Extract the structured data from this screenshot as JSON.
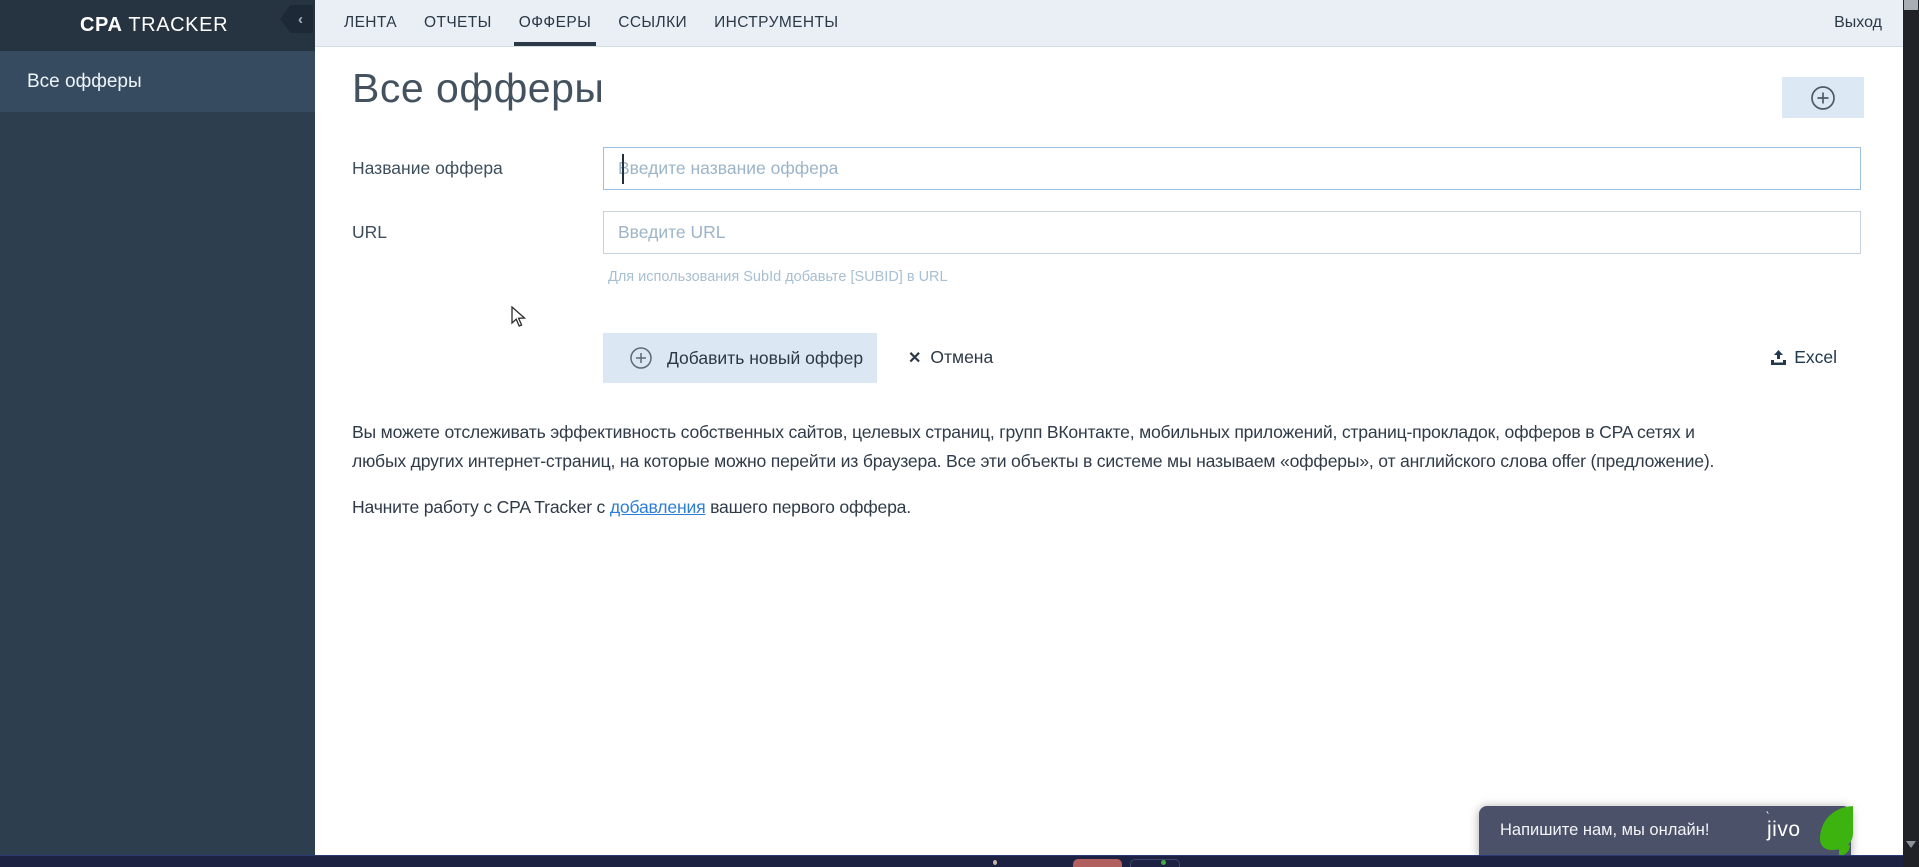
{
  "app": {
    "brand_bold": "CPA",
    "brand_rest": " TRACKER"
  },
  "sidebar": {
    "items": [
      {
        "label": "Все офферы",
        "active": true
      }
    ],
    "collapse_glyph": "‹"
  },
  "nav": {
    "tabs": [
      {
        "label": "ЛЕНТА",
        "active": false
      },
      {
        "label": "ОТЧЕТЫ",
        "active": false
      },
      {
        "label": "ОФФЕРЫ",
        "active": true
      },
      {
        "label": "ССЫЛКИ",
        "active": false
      },
      {
        "label": "ИНСТРУМЕНТЫ",
        "active": false
      }
    ],
    "logout_label": "Выход"
  },
  "page": {
    "title": "Все офферы"
  },
  "form": {
    "name_label": "Название оффера",
    "name_value": "",
    "name_placeholder": "Введите название оффера",
    "url_label": "URL",
    "url_value": "",
    "url_placeholder": "Введите URL",
    "url_hint": "Для использования SubId добавьте [SUBID] в URL",
    "submit_label": "Добавить новый оффер",
    "cancel_label": "Отмена",
    "cancel_glyph": "✕",
    "excel_label": "Excel"
  },
  "intro": {
    "line1": "Вы можете отслеживать эффективность собственных сайтов, целевых страниц, групп ВКонтакте, мобильных приложений, страниц-прокладок, офферов в CPA сетях и",
    "line2": "любых других интернет-страниц, на которые можно перейти из браузера. Все эти объекты в системе мы называем «офферы», от английского слова offer (предложение).",
    "start_prefix": "Начните работу с CPA Tracker с ",
    "start_link": "добавления",
    "start_suffix": " вашего первого оффера."
  },
  "chat": {
    "message": "Напишите нам, мы онлайн!",
    "brand": "jivo"
  },
  "colors": {
    "sidebar_bg": "#2d3e4f",
    "sidebar_header_bg": "#263340",
    "active_item_bg": "#364b5f",
    "nav_bg": "#e9eff5",
    "accent_dark": "#2b3947",
    "button_bg": "#dbe8f3",
    "focused_input_border": "#9cc0de",
    "link": "#2e7ed5",
    "hint": "#a7bfd1",
    "jivo_bg": "#4b5168",
    "jivo_green": "#3db310"
  }
}
